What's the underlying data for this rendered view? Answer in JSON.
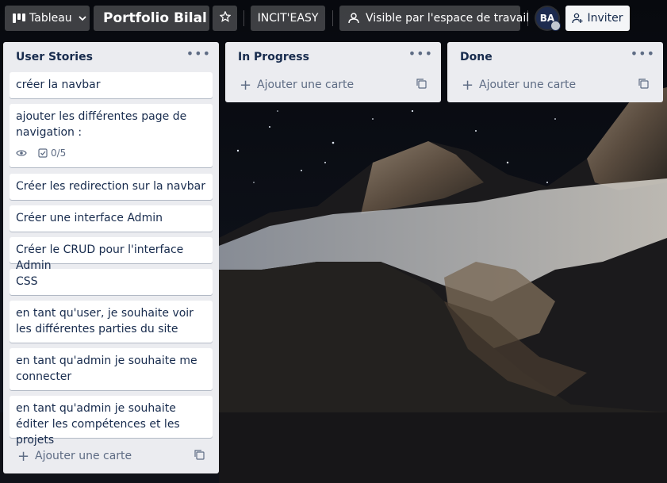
{
  "topbar": {
    "board_view_label": "Tableau",
    "board_title": "Portfolio Bilal",
    "workspace_label": "INCIT'EASY",
    "visibility_label": "Visible par l'espace de travail",
    "avatar_initials": "BA",
    "invite_label": "Inviter"
  },
  "lists": [
    {
      "title": "User Stories",
      "cards": [
        {
          "text": "créer la navbar"
        },
        {
          "text": "ajouter les différentes page de navigation :",
          "checklist": "0/5",
          "has_watch": true
        },
        {
          "text": "Créer les redirection sur la navbar"
        },
        {
          "text": "Créer une interface Admin"
        },
        {
          "text": "Créer le CRUD pour l'interface Admin"
        },
        {
          "text": "CSS"
        },
        {
          "text": "en tant qu'user, je souhaite voir les différentes parties du site"
        },
        {
          "text": "en tant qu'admin je souhaite me connecter"
        },
        {
          "text": "en tant qu'admin je souhaite éditer les compétences et les projets"
        }
      ],
      "add_card_label": "Ajouter une carte"
    },
    {
      "title": "In Progress",
      "cards": [],
      "add_card_label": "Ajouter une carte"
    },
    {
      "title": "Done",
      "cards": [],
      "add_card_label": "Ajouter une carte"
    }
  ],
  "colors": {
    "list_bg": "#ebecf0",
    "card_bg": "#ffffff",
    "text": "#172b4d",
    "muted": "#5e6c84"
  }
}
